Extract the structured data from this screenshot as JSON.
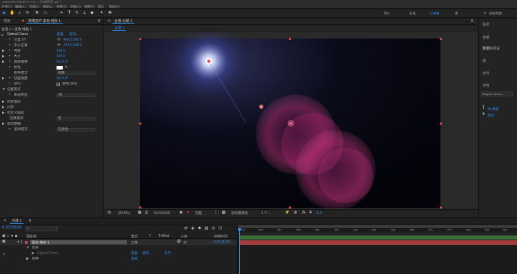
{
  "title_bar": {
    "title": "Adobe After Effects CC 2017 - 无标题项目.aep *"
  },
  "menu": [
    "文件(F)",
    "编辑(E)",
    "合成(C)",
    "图层(L)",
    "效果(T)",
    "动画(A)",
    "视图(V)",
    "窗口",
    "帮助(H)"
  ],
  "toolbar": {
    "workspaces": [
      "默认",
      "标准",
      "小屏幕",
      "库"
    ],
    "active_workspace": "小屏幕",
    "search_placeholder": "搜索帮助",
    "tools": [
      "selection-tool",
      "hand-tool",
      "zoom-tool",
      "camera-orbit-tool",
      "pan-behind-tool",
      "rectangle-tool",
      "pen-tool",
      "type-tool",
      "brush-tool",
      "clone-stamp-tool",
      "eraser-tool",
      "roto-brush-tool",
      "puppet-pin-tool"
    ]
  },
  "left_panel": {
    "tabs": [
      "项目",
      "效果控件 黑色 纯色 1",
      "≡"
    ],
    "tab_project": "项目",
    "tab_effect": "效果控件 黑色 纯色 1",
    "header": "合成 1 • 黑色 纯色 1",
    "rows": [
      {
        "label": "Optical Flares",
        "value": "重置",
        "value2": "选项...",
        "fx": true
      },
      {
        "label": "位置 XY",
        "value": "420.0,190.0"
      },
      {
        "label": "中心位置",
        "value": "372.0,428.0"
      },
      {
        "label": "亮度",
        "value": "100.0"
      },
      {
        "label": "大小",
        "value": "100.0"
      },
      {
        "label": "旋转偏移",
        "value": "0x+0.0°"
      },
      {
        "label": "颜色",
        "value": ""
      },
      {
        "label": "颜色模式",
        "value": "相乘"
      },
      {
        "label": "动画速度",
        "value": "0x+0.0°"
      },
      {
        "label": "GPU",
        "value": "使用 GPU"
      },
      {
        "label": "位置模式",
        "value": ""
      },
      {
        "label": "来源类型",
        "value": "2D"
      },
      {
        "label": "前景图层",
        "value": ""
      },
      {
        "label": "闪烁",
        "value": ""
      },
      {
        "label": "自定义图层",
        "value": ""
      },
      {
        "label": "前景遮罩",
        "value": "无"
      },
      {
        "label": "运动模糊",
        "value": ""
      },
      {
        "label": "渲染模式",
        "value": "在黑色"
      }
    ]
  },
  "comp_panel": {
    "tab": "合成 合成 1",
    "subtab": "合成 1",
    "footer": {
      "zoom": "(34.0%)",
      "timecode": "0;00;00;00",
      "resolution": "完整",
      "camera": "活动摄像机",
      "views": "1 个...",
      "exposure": "+0.0"
    }
  },
  "right_panel": {
    "items": [
      "信息",
      "音频",
      "预览",
      "效果和预设",
      "库",
      "对齐",
      "字符",
      "段落"
    ],
    "font": "Magneto Scroll (...",
    "font_size": "36 像素",
    "leading": "自动"
  },
  "timeline": {
    "tab": "合成 1",
    "timecode": "0;00;00;00",
    "search_placeholder": "",
    "columns": [
      "源名称",
      "模式",
      "T",
      "TrkMat",
      "父级",
      "持续时间"
    ],
    "layer_name": "黑色 纯色 1",
    "layer_number": "1",
    "layer_mode": "正常",
    "layer_parent": "无",
    "layer_duration": "0;00;30;00",
    "sub_rows": [
      {
        "label": "效果",
        "value": ""
      },
      {
        "label": "Optical Flares",
        "value": "重置",
        "extra": "选项...",
        "extra2": "关于..."
      },
      {
        "label": "变换",
        "value": "重置"
      }
    ],
    "ruler": [
      "0s",
      "02s",
      "04s",
      "06s",
      "08s",
      "10s",
      "12s",
      "14s",
      "16s",
      "18s",
      "20s",
      "22s",
      "24s",
      "26s",
      "28s",
      "30s"
    ]
  },
  "colors": {
    "accent": "#2d8ceb",
    "track": "#3d6d3a",
    "layer_bar": "#a33d3d"
  }
}
